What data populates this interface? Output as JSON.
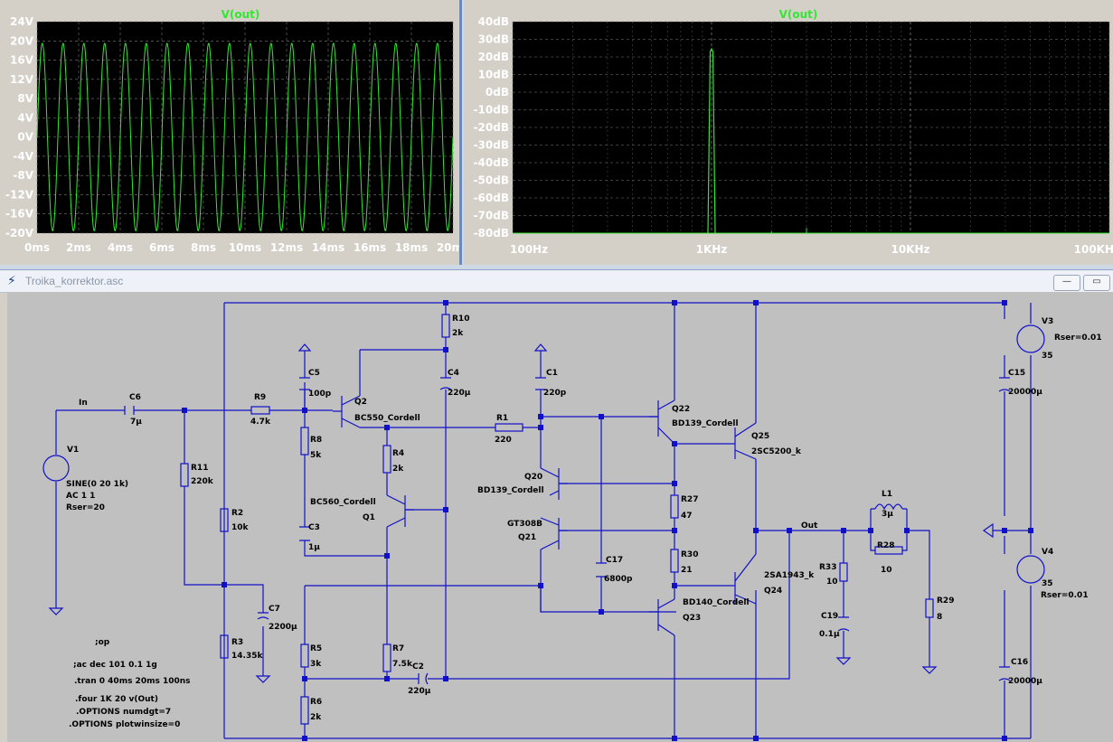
{
  "transient_plot": {
    "title": "V(out)",
    "y_ticks": [
      "24V",
      "20V",
      "16V",
      "12V",
      "8V",
      "4V",
      "0V",
      "-4V",
      "-8V",
      "-12V",
      "-16V",
      "-20V"
    ],
    "x_ticks": [
      "0ms",
      "2ms",
      "4ms",
      "6ms",
      "8ms",
      "10ms",
      "12ms",
      "14ms",
      "16ms",
      "18ms",
      "20ms"
    ],
    "trace_color": "#33e633",
    "background": "#000000"
  },
  "fft_plot": {
    "title": "V(out)",
    "y_ticks": [
      "40dB",
      "30dB",
      "20dB",
      "10dB",
      "0dB",
      "-10dB",
      "-20dB",
      "-30dB",
      "-40dB",
      "-50dB",
      "-60dB",
      "-70dB",
      "-80dB"
    ],
    "x_ticks": [
      "100Hz",
      "1KHz",
      "10KHz",
      "100KHz"
    ],
    "trace_color": "#33e633",
    "background": "#000000"
  },
  "chart_data": [
    {
      "type": "line",
      "title": "V(out)",
      "xlabel": "",
      "ylabel": "",
      "x_unit": "ms",
      "xlim": [
        0,
        20
      ],
      "ylim": [
        -20,
        24
      ],
      "series": [
        {
          "name": "V(out)",
          "waveform": "sine",
          "amplitude": 19.5,
          "frequency_hz": 1000,
          "offset": 0
        }
      ]
    },
    {
      "type": "line",
      "title": "V(out)",
      "xlabel": "",
      "ylabel": "",
      "x_scale": "log",
      "xlim": [
        "100Hz",
        "100KHz"
      ],
      "ylim": [
        -80,
        40
      ],
      "series": [
        {
          "name": "V(out)",
          "points": [
            {
              "x": 1000,
              "y": 23
            },
            {
              "x": 2000,
              "y": -79
            },
            {
              "x": 3000,
              "y": -77
            }
          ]
        }
      ]
    }
  ],
  "schematic_window": {
    "title": "Troika_korrektor.asc",
    "minimize_label": "—",
    "maximize_label": "▭"
  },
  "schematic": {
    "labels": {
      "In": "In",
      "C6": "C6",
      "C6v": "7µ",
      "R9": "R9",
      "R9v": "4.7k",
      "V1": "V1",
      "V1_spec1": "SINE(0 20 1k)",
      "V1_spec2": "AC 1 1",
      "V1_spec3": "Rser=20",
      "R11": "R11",
      "R11v": "220k",
      "R2": "R2",
      "R2v": "10k",
      "R3": "R3",
      "R3v": "14.35k",
      "C7": "C7",
      "C7v": "2200µ",
      "C5": "C5",
      "C5v": "100p",
      "R8": "R8",
      "R8v": "5k",
      "C3": "C3",
      "C3v": "1µ",
      "Q2": "Q2",
      "Q2m": "BC550_Cordell",
      "R10": "R10",
      "R10v": "2k",
      "C4": "C4",
      "C4v": "220µ",
      "R4": "R4",
      "R4v": "2k",
      "Q1m": "BC560_Cordell",
      "Q1": "Q1",
      "R5": "R5",
      "R5v": "3k",
      "R6": "R6",
      "R6v": "2k",
      "R7": "R7",
      "R7v": "7.5k",
      "C2": "C2",
      "C2v": "220µ",
      "R1": "R1",
      "R1v": "220",
      "C1": "C1",
      "C1v": "220p",
      "Q20": "Q20",
      "Q20m": "BD139_Cordell",
      "Q21m": "GT308B",
      "Q21": "Q21",
      "C17": "C17",
      "C17v": "6800p",
      "Q22": "Q22",
      "Q22m": "BD139_Cordell",
      "R27": "R27",
      "R27v": "47",
      "R30": "R30",
      "R30v": "21",
      "Q23m": "BD140_Cordell",
      "Q23": "Q23",
      "Q25": "Q25",
      "Q25m": "2SC5200_k",
      "Q24m": "2SA1943_k",
      "Q24": "Q24",
      "Out": "Out",
      "L1": "L1",
      "L1v": "3µ",
      "R28": "R28",
      "R28v": "10",
      "R33": "R33",
      "R33v": "10",
      "C19": "C19",
      "C19v": "0.1µ",
      "R29": "R29",
      "R29v": "8",
      "V3": "V3",
      "V3v": "35",
      "V3r": "Rser=0.01",
      "C15": "C15",
      "C15v": "20000µ",
      "V4": "V4",
      "V4v": "35",
      "V4r": "Rser=0.01",
      "C16": "C16",
      "C16v": "20000µ"
    },
    "directives": [
      ";op",
      ";ac dec 101 0.1 1g",
      ".tran 0 40ms 20ms 100ns",
      ".four 1K 20 v(Out)",
      ".OPTIONS numdgt=7",
      ".OPTIONS plotwinsize=0"
    ],
    "wire_color": "#1010c8",
    "component_color": "#1010c8"
  }
}
